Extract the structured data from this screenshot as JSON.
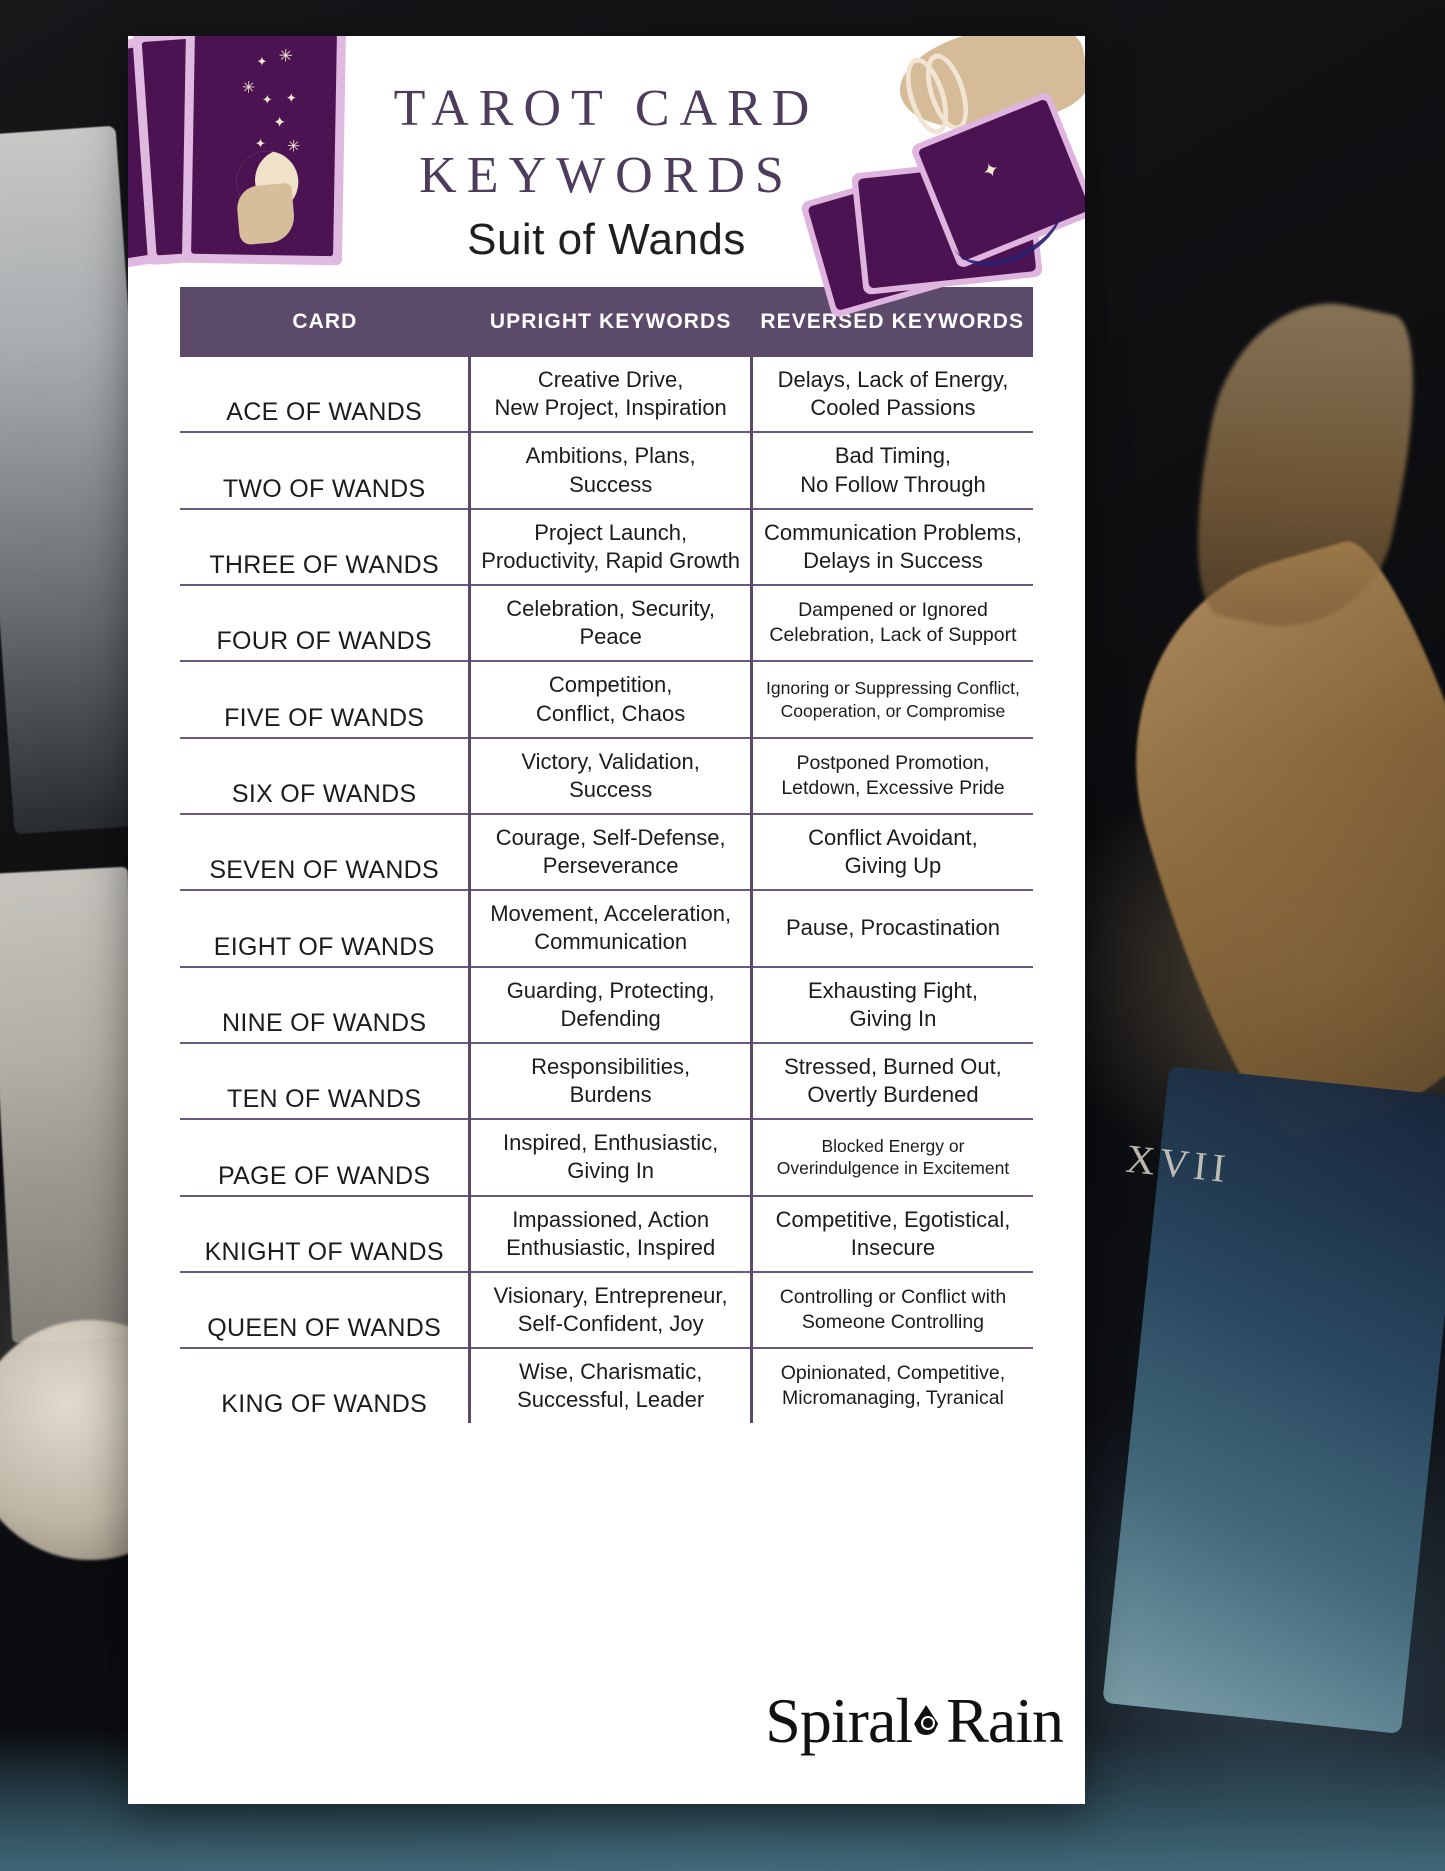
{
  "header": {
    "title_line1": "TAROT CARD",
    "title_line2": "KEYWORDS",
    "subtitle": "Suit of Wands"
  },
  "table": {
    "columns": [
      "CARD",
      "UPRIGHT KEYWORDS",
      "REVERSED KEYWORDS"
    ],
    "rows": [
      {
        "card": "ACE OF WANDS",
        "upright": "Creative Drive,\nNew Project, Inspiration",
        "reversed": "Delays, Lack of Energy,\nCooled Passions"
      },
      {
        "card": "TWO OF WANDS",
        "upright": "Ambitions, Plans,\nSuccess",
        "reversed": "Bad Timing,\nNo Follow Through"
      },
      {
        "card": "THREE OF WANDS",
        "upright": "Project Launch,\nProductivity, Rapid Growth",
        "reversed": "Communication Problems,\nDelays in Success"
      },
      {
        "card": "FOUR OF WANDS",
        "upright": "Celebration, Security,\nPeace",
        "reversed": "Dampened or Ignored\nCelebration, Lack of Support"
      },
      {
        "card": "FIVE OF WANDS",
        "upright": "Competition,\nConflict, Chaos",
        "reversed": "Ignoring or Suppressing Conflict,\nCooperation, or Compromise"
      },
      {
        "card": "SIX OF WANDS",
        "upright": "Victory, Validation,\nSuccess",
        "reversed": "Postponed Promotion,\nLetdown, Excessive Pride"
      },
      {
        "card": "SEVEN OF WANDS",
        "upright": "Courage, Self-Defense,\nPerseverance",
        "reversed": "Conflict Avoidant,\nGiving Up"
      },
      {
        "card": "EIGHT OF WANDS",
        "upright": "Movement, Acceleration,\nCommunication",
        "reversed": "Pause, Procastination"
      },
      {
        "card": "NINE OF WANDS",
        "upright": "Guarding, Protecting,\nDefending",
        "reversed": "Exhausting Fight,\nGiving In"
      },
      {
        "card": "TEN OF WANDS",
        "upright": "Responsibilities,\nBurdens",
        "reversed": "Stressed, Burned Out,\nOvertly Burdened"
      },
      {
        "card": "PAGE OF WANDS",
        "upright": "Inspired, Enthusiastic,\nGiving In",
        "reversed": "Blocked Energy or\nOverindulgence in Excitement"
      },
      {
        "card": "KNIGHT OF WANDS",
        "upright": "Impassioned, Action\nEnthusiastic, Inspired",
        "reversed": "Competitive, Egotistical,\nInsecure"
      },
      {
        "card": "QUEEN OF WANDS",
        "upright": "Visionary, Entrepreneur,\nSelf-Confident, Joy",
        "reversed": "Controlling or Conflict with\nSomeone Controlling"
      },
      {
        "card": "KING OF WANDS",
        "upright": "Wise, Charismatic,\nSuccessful, Leader",
        "reversed": "Opinionated,  Competitive,\nMicromanaging, Tyranical"
      }
    ],
    "reversed_size_class": [
      "",
      "",
      "",
      "small",
      "xsmall",
      "small",
      "",
      "",
      "",
      "",
      "xsmall",
      "",
      "small",
      "small"
    ]
  },
  "logo": {
    "text_left": "Spiral",
    "text_right": "Rain"
  },
  "background": {
    "roman_numeral": "XVII"
  },
  "colors": {
    "header_purple": "#5b4a6a",
    "title_purple": "#4d3c5c",
    "card_purple": "#4b1352",
    "card_border_pink": "#e0b9e0",
    "rule_purple": "#6b5880"
  }
}
